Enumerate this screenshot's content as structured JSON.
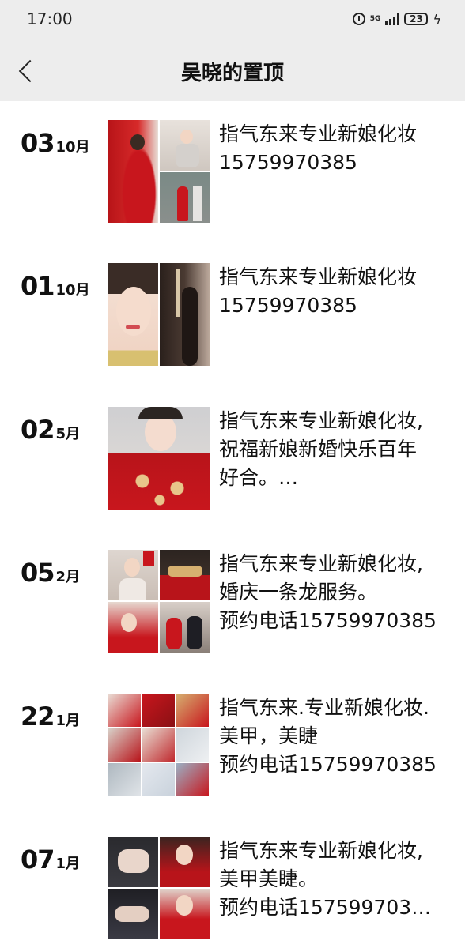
{
  "status_bar": {
    "time": "17:00",
    "network": "5G",
    "battery": "23"
  },
  "header": {
    "title": "吴晓的置顶"
  },
  "posts": [
    {
      "day": "03",
      "month": "10月",
      "caption": "指气东来专业新娘化妆\n15759970385",
      "image_count": 4
    },
    {
      "day": "01",
      "month": "10月",
      "caption": "指气东来专业新娘化妆\n15759970385",
      "image_count": 2
    },
    {
      "day": "02",
      "month": "5月",
      "caption": "指气东来专业新娘化妆,\n祝福新娘新婚快乐百年\n好合。…",
      "image_count": 1
    },
    {
      "day": "05",
      "month": "2月",
      "caption": "指气东来专业新娘化妆,\n婚庆一条龙服务。\n预约电话15759970385",
      "image_count": 4
    },
    {
      "day": "22",
      "month": "1月",
      "caption": "指气东来.专业新娘化妆.\n美甲，美睫\n预约电话15759970385",
      "image_count": 9
    },
    {
      "day": "07",
      "month": "1月",
      "caption": "指气东来专业新娘化妆,\n美甲美睫。\n预约电话157599703…",
      "image_count": 4
    }
  ],
  "colors": {
    "header_bg": "#ededed",
    "bridal_red": "#c8161d",
    "background": "#ffffff"
  }
}
